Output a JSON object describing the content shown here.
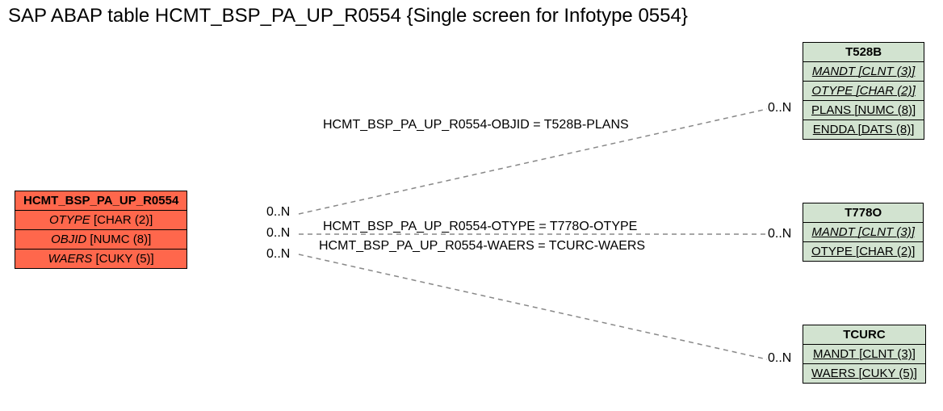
{
  "title": "SAP ABAP table HCMT_BSP_PA_UP_R0554 {Single screen for Infotype 0554}",
  "left_entity": {
    "name": "HCMT_BSP_PA_UP_R0554",
    "fields": [
      {
        "name": "OTYPE",
        "type": "[CHAR (2)]"
      },
      {
        "name": "OBJID",
        "type": "[NUMC (8)]"
      },
      {
        "name": "WAERS",
        "type": "[CUKY (5)]"
      }
    ]
  },
  "right_entities": [
    {
      "name": "T528B",
      "fields": [
        {
          "name": "MANDT",
          "type": "[CLNT (3)]",
          "key": true
        },
        {
          "name": "OTYPE",
          "type": "[CHAR (2)]",
          "key": true
        },
        {
          "name": "PLANS",
          "type": "[NUMC (8)]",
          "key": false
        },
        {
          "name": "ENDDA",
          "type": "[DATS (8)]",
          "key": false
        }
      ]
    },
    {
      "name": "T778O",
      "fields": [
        {
          "name": "MANDT",
          "type": "[CLNT (3)]",
          "key": true
        },
        {
          "name": "OTYPE",
          "type": "[CHAR (2)]",
          "key": false
        }
      ]
    },
    {
      "name": "TCURC",
      "fields": [
        {
          "name": "MANDT",
          "type": "[CLNT (3)]",
          "key": false
        },
        {
          "name": "WAERS",
          "type": "[CUKY (5)]",
          "key": false
        }
      ]
    }
  ],
  "relations": [
    {
      "label": "HCMT_BSP_PA_UP_R0554-OBJID = T528B-PLANS",
      "left_card": "0..N",
      "right_card": "0..N"
    },
    {
      "label": "HCMT_BSP_PA_UP_R0554-OTYPE = T778O-OTYPE",
      "left_card": "0..N",
      "right_card": "0..N"
    },
    {
      "label": "HCMT_BSP_PA_UP_R0554-WAERS = TCURC-WAERS",
      "left_card": "0..N",
      "right_card": "0..N"
    }
  ]
}
